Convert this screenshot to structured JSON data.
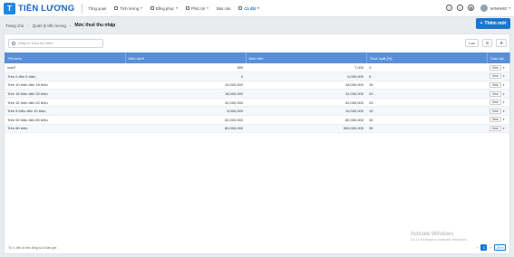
{
  "app": {
    "logo_letter": "T",
    "brand": "TIỀN LƯƠNG"
  },
  "nav": [
    {
      "label": "Tổng quan",
      "has_caret": false,
      "active": false
    },
    {
      "label": "Tính lương",
      "has_caret": true,
      "active": false
    },
    {
      "label": "Đồng phục",
      "has_caret": true,
      "active": false
    },
    {
      "label": "Phúc lợi",
      "has_caret": true,
      "active": false
    },
    {
      "label": "Báo cáo",
      "has_caret": false,
      "active": false
    },
    {
      "label": "Cá đặt",
      "has_caret": true,
      "active": true
    }
  ],
  "user": {
    "name": "VANHHIG"
  },
  "breadcrumb": {
    "home": "Trang chủ",
    "parent": "Quản lý tiền lương",
    "current": "Mức thuế thu nhập"
  },
  "add_button": {
    "label": "Thêm mới"
  },
  "search": {
    "placeholder": "Nhập từ khóa tìm kiếm"
  },
  "tools": {
    "filter_label": "Lọc"
  },
  "table": {
    "columns": [
      "Tên mức",
      "Mức dưới",
      "Mức trên",
      "Thuế suất (%)",
      "Thao tác"
    ],
    "action_label": "Xem",
    "rows": [
      [
        "mar2",
        "399",
        "7,000",
        "4"
      ],
      [
        "Trên 0 đến 5 triệu",
        "0",
        "5,000,000",
        "5"
      ],
      [
        "Trên 10 triệu đến 18 triệu",
        "10,000,000",
        "18,000,000",
        "15"
      ],
      [
        "Trên 18 triệu đến 32 triệu",
        "18,000,000",
        "32,000,000",
        "20"
      ],
      [
        "Trên 32 triệu đến 52 triệu",
        "32,000,000",
        "52,000,000",
        "25"
      ],
      [
        "Trên 5 triệu đến 10 triệu",
        "5,000,000",
        "10,000,000",
        "10"
      ],
      [
        "Trên 52 triệu đến 80 triệu",
        "52,000,000",
        "80,000,000",
        "30"
      ],
      [
        "Trên 80 triệu",
        "80,000,000",
        "900,000,000",
        "35"
      ]
    ]
  },
  "footer": {
    "summary": "Từ 1 đến 8 trên tổng số 8 bản ghi"
  },
  "pager": {
    "current_page": "1",
    "page_size": "20"
  },
  "watermark": {
    "line1": "Activate Windows",
    "line2": "Go to Settings to activate Windows."
  }
}
